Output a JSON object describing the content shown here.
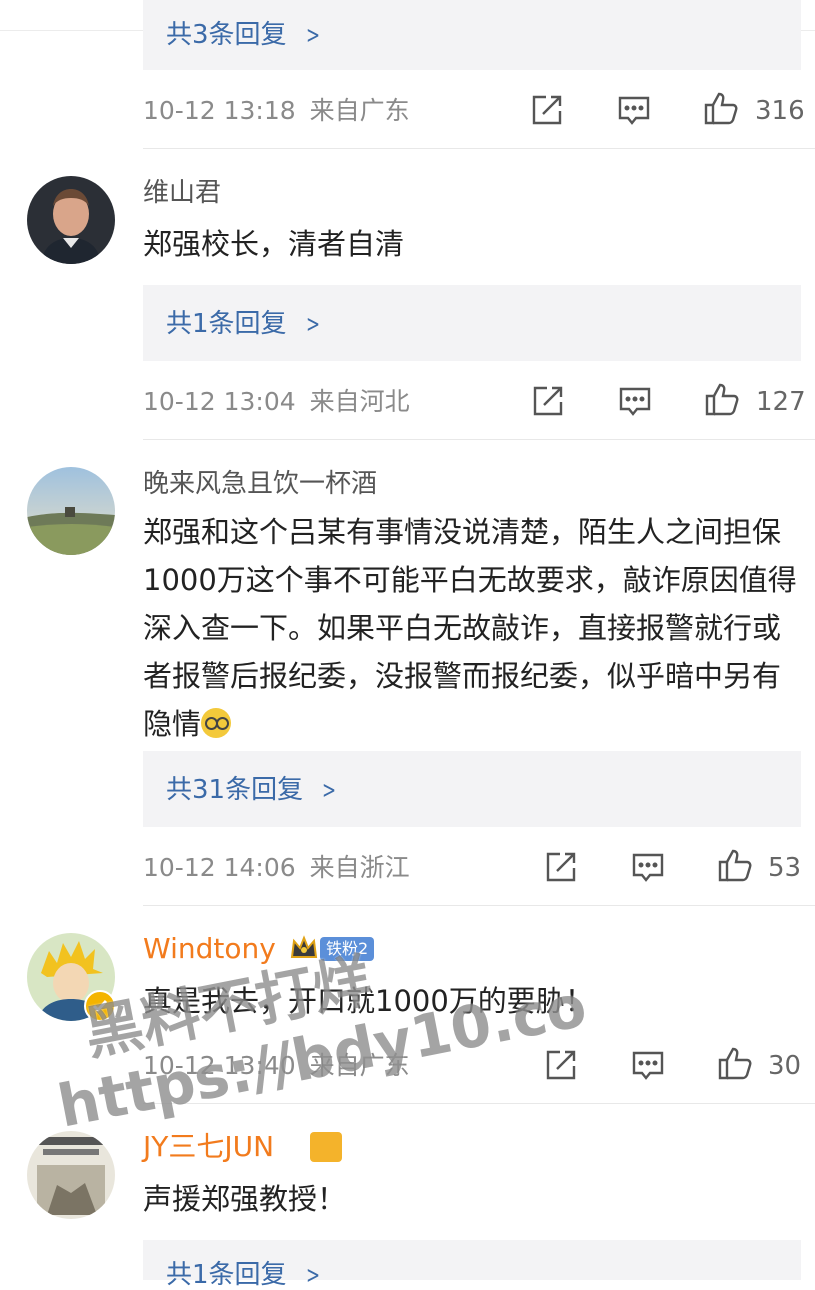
{
  "comments": [
    {
      "replies_label": "共3条回复",
      "time": "10-12 13:18",
      "location": "来自广东",
      "likes": "316"
    },
    {
      "username": "维山君",
      "text": "郑强校长，清者自清",
      "replies_label": "共1条回复",
      "time": "10-12 13:04",
      "location": "来自河北",
      "likes": "127"
    },
    {
      "username": "晚来风急且饮一杯酒",
      "text": "郑强和这个吕某有事情没说清楚，陌生人之间担保1000万这个事不可能平白无故要求，敲诈原因值得深入查一下。如果平白无故敲诈，直接报警就行或者报警后报纪委，没报警而报纪委，似乎暗中另有隐情",
      "replies_label": "共31条回复",
      "time": "10-12 14:06",
      "location": "来自浙江",
      "likes": "53"
    },
    {
      "username": "Windtony",
      "fan_badge": "铁粉2",
      "text": "真是我去，开口就1000万的要胁！",
      "time": "10-12 13:40",
      "location": "来自广东",
      "likes": "30"
    },
    {
      "username": "JY三七JUN",
      "text": "声援郑强教授！",
      "replies_label": "共1条回复"
    }
  ],
  "watermark": {
    "line1": "黑料不打烊",
    "line2": "https://bdy10.co"
  },
  "colors": {
    "link": "#3b6aa8",
    "vip_name": "#f27b1d",
    "reply_bg": "#f3f3f5",
    "meta": "#8a8a8a",
    "badge": "#5b8fd9"
  },
  "icons": {
    "share": "share-icon",
    "comment": "comment-icon",
    "like": "thumbs-up-icon",
    "crown": "crown-icon",
    "verified": "verified-icon"
  }
}
